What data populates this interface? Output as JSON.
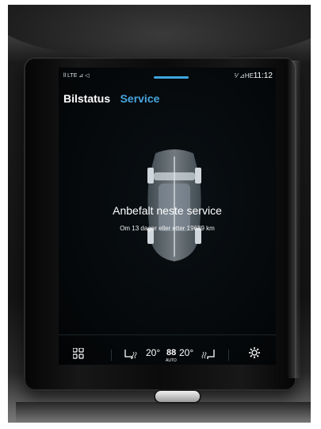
{
  "status_bar": {
    "left": "ll LTE ⊿ ◁",
    "right": "⅟ ⊿HE",
    "time": "11:12"
  },
  "tabs": [
    {
      "label": "Bilstatus"
    },
    {
      "label": "Service"
    }
  ],
  "service": {
    "title": "Anbefalt neste service",
    "subtitle": "Om 13 dager eller etter 19689 km"
  },
  "climate": {
    "left_temp": "20°",
    "right_temp": "20°",
    "fan_label": "88",
    "auto_label": "AUTO"
  },
  "colors": {
    "accent": "#48a6df",
    "screen_bg": "#05080a"
  },
  "icons": [
    "car-icon",
    "grid-icon",
    "seat-heat-icon",
    "fan-icon",
    "gear-icon"
  ]
}
